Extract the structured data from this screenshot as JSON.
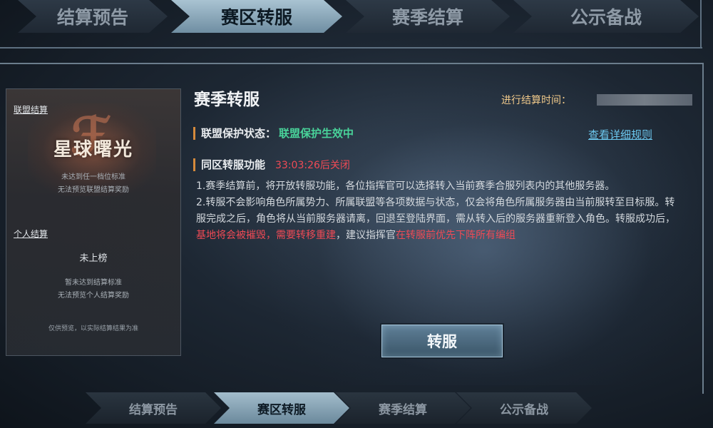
{
  "top_tabs": [
    {
      "label": "结算预告",
      "active": false
    },
    {
      "label": "赛区转服",
      "active": true
    },
    {
      "label": "赛季结算",
      "active": false
    },
    {
      "label": "公示备战",
      "active": false
    }
  ],
  "left_card": {
    "alliance_section_title": "联盟结算",
    "alliance_name": "星球曙光",
    "alliance_note_1": "未达到任一档位标准",
    "alliance_note_2": "无法预览联盟结算奖励",
    "personal_section_title": "个人结算",
    "personal_rank": "未上榜",
    "personal_note_1": "暂未达到结算标准",
    "personal_note_2": "无法预览个人结算奖励",
    "footer_note": "仅供预览，以实际结算结果为准"
  },
  "content": {
    "title": "赛季转服",
    "settlement_time_label": "进行结算时间：",
    "protection_label": "联盟保护状态：",
    "protection_value": "联盟保护生效中",
    "rules_link": "查看详细规则",
    "feature_label": "同区转服功能",
    "countdown": "33:03:26后关闭",
    "desc_1": "1.赛季结算前，将开放转服功能，各位指挥官可以选择转入当前赛季合服列表内的其他服务器。",
    "desc_2a": "2.转服不会影响角色所属势力、所属联盟等各项数据与状态，仅会将角色所属服务器由当前服转至目标服。转服完成之后，角色将从当前服务器请离，回退至登陆界面，需从转入后的服务器重新登入角色。转服成功后，",
    "desc_2_red1": "基地将会被摧毁，需要转移重建",
    "desc_2b": "，建议指挥官",
    "desc_2_red2": "在转服前优先下阵所有编组"
  },
  "transfer_button": "转服",
  "bottom_tabs": [
    {
      "label": "结算预告",
      "active": false
    },
    {
      "label": "赛区转服",
      "active": true
    },
    {
      "label": "赛季结算",
      "active": false
    },
    {
      "label": "公示备战",
      "active": false
    }
  ],
  "colors": {
    "accent_green": "#49d39a",
    "accent_red": "#ef4a55",
    "link_blue": "#6cc8ef",
    "settle_gold": "#f0c98a"
  }
}
